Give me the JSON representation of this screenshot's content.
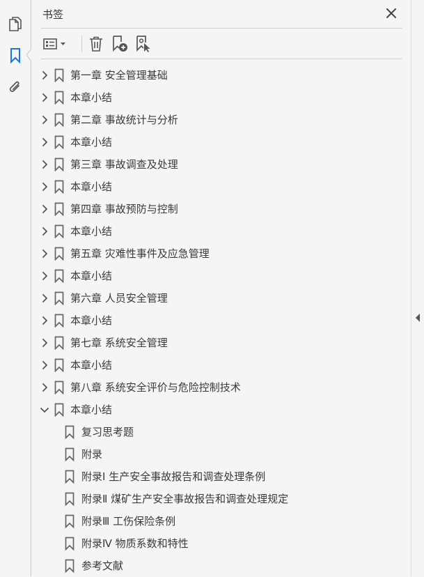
{
  "panel": {
    "title": "书签"
  },
  "rail": {
    "icons": [
      "pages-icon",
      "bookmark-icon",
      "attachment-icon"
    ],
    "active": "bookmark-icon"
  },
  "toolbar": {
    "icons": [
      "options-menu-icon",
      "delete-icon",
      "new-bookmark-icon",
      "bookmark-properties-icon"
    ]
  },
  "colors": {
    "accent": "#1a73e8",
    "icon": "#555555",
    "text": "#3a3a3a"
  },
  "bookmarks": [
    {
      "label": "第一章  安全管理基础",
      "level": 0,
      "state": "collapsed"
    },
    {
      "label": "本章小结",
      "level": 0,
      "state": "collapsed"
    },
    {
      "label": "第二章  事故统计与分析",
      "level": 0,
      "state": "collapsed"
    },
    {
      "label": "本章小结",
      "level": 0,
      "state": "collapsed"
    },
    {
      "label": "第三章  事故调查及处理",
      "level": 0,
      "state": "collapsed"
    },
    {
      "label": "本章小结",
      "level": 0,
      "state": "collapsed"
    },
    {
      "label": "第四章  事故预防与控制",
      "level": 0,
      "state": "collapsed"
    },
    {
      "label": "本章小结",
      "level": 0,
      "state": "collapsed"
    },
    {
      "label": "第五章  灾难性事件及应急管理",
      "level": 0,
      "state": "collapsed"
    },
    {
      "label": "本章小结",
      "level": 0,
      "state": "collapsed"
    },
    {
      "label": "第六章  人员安全管理",
      "level": 0,
      "state": "collapsed"
    },
    {
      "label": "本章小结",
      "level": 0,
      "state": "collapsed"
    },
    {
      "label": "第七章  系统安全管理",
      "level": 0,
      "state": "collapsed"
    },
    {
      "label": "本章小结",
      "level": 0,
      "state": "collapsed"
    },
    {
      "label": "第八章  系统安全评价与危险控制技术",
      "level": 0,
      "state": "collapsed"
    },
    {
      "label": "本章小结",
      "level": 0,
      "state": "expanded"
    },
    {
      "label": "复习思考题",
      "level": 1,
      "state": "leaf"
    },
    {
      "label": "附录",
      "level": 1,
      "state": "leaf"
    },
    {
      "label": "附录Ⅰ  生产安全事故报告和调查处理条例",
      "level": 1,
      "state": "leaf"
    },
    {
      "label": "附录Ⅱ  煤矿生产安全事故报告和调查处理规定",
      "level": 1,
      "state": "leaf"
    },
    {
      "label": "附录Ⅲ  工伤保险条例",
      "level": 1,
      "state": "leaf"
    },
    {
      "label": "附录Ⅳ  物质系数和特性",
      "level": 1,
      "state": "leaf"
    },
    {
      "label": "参考文献",
      "level": 1,
      "state": "leaf"
    }
  ]
}
